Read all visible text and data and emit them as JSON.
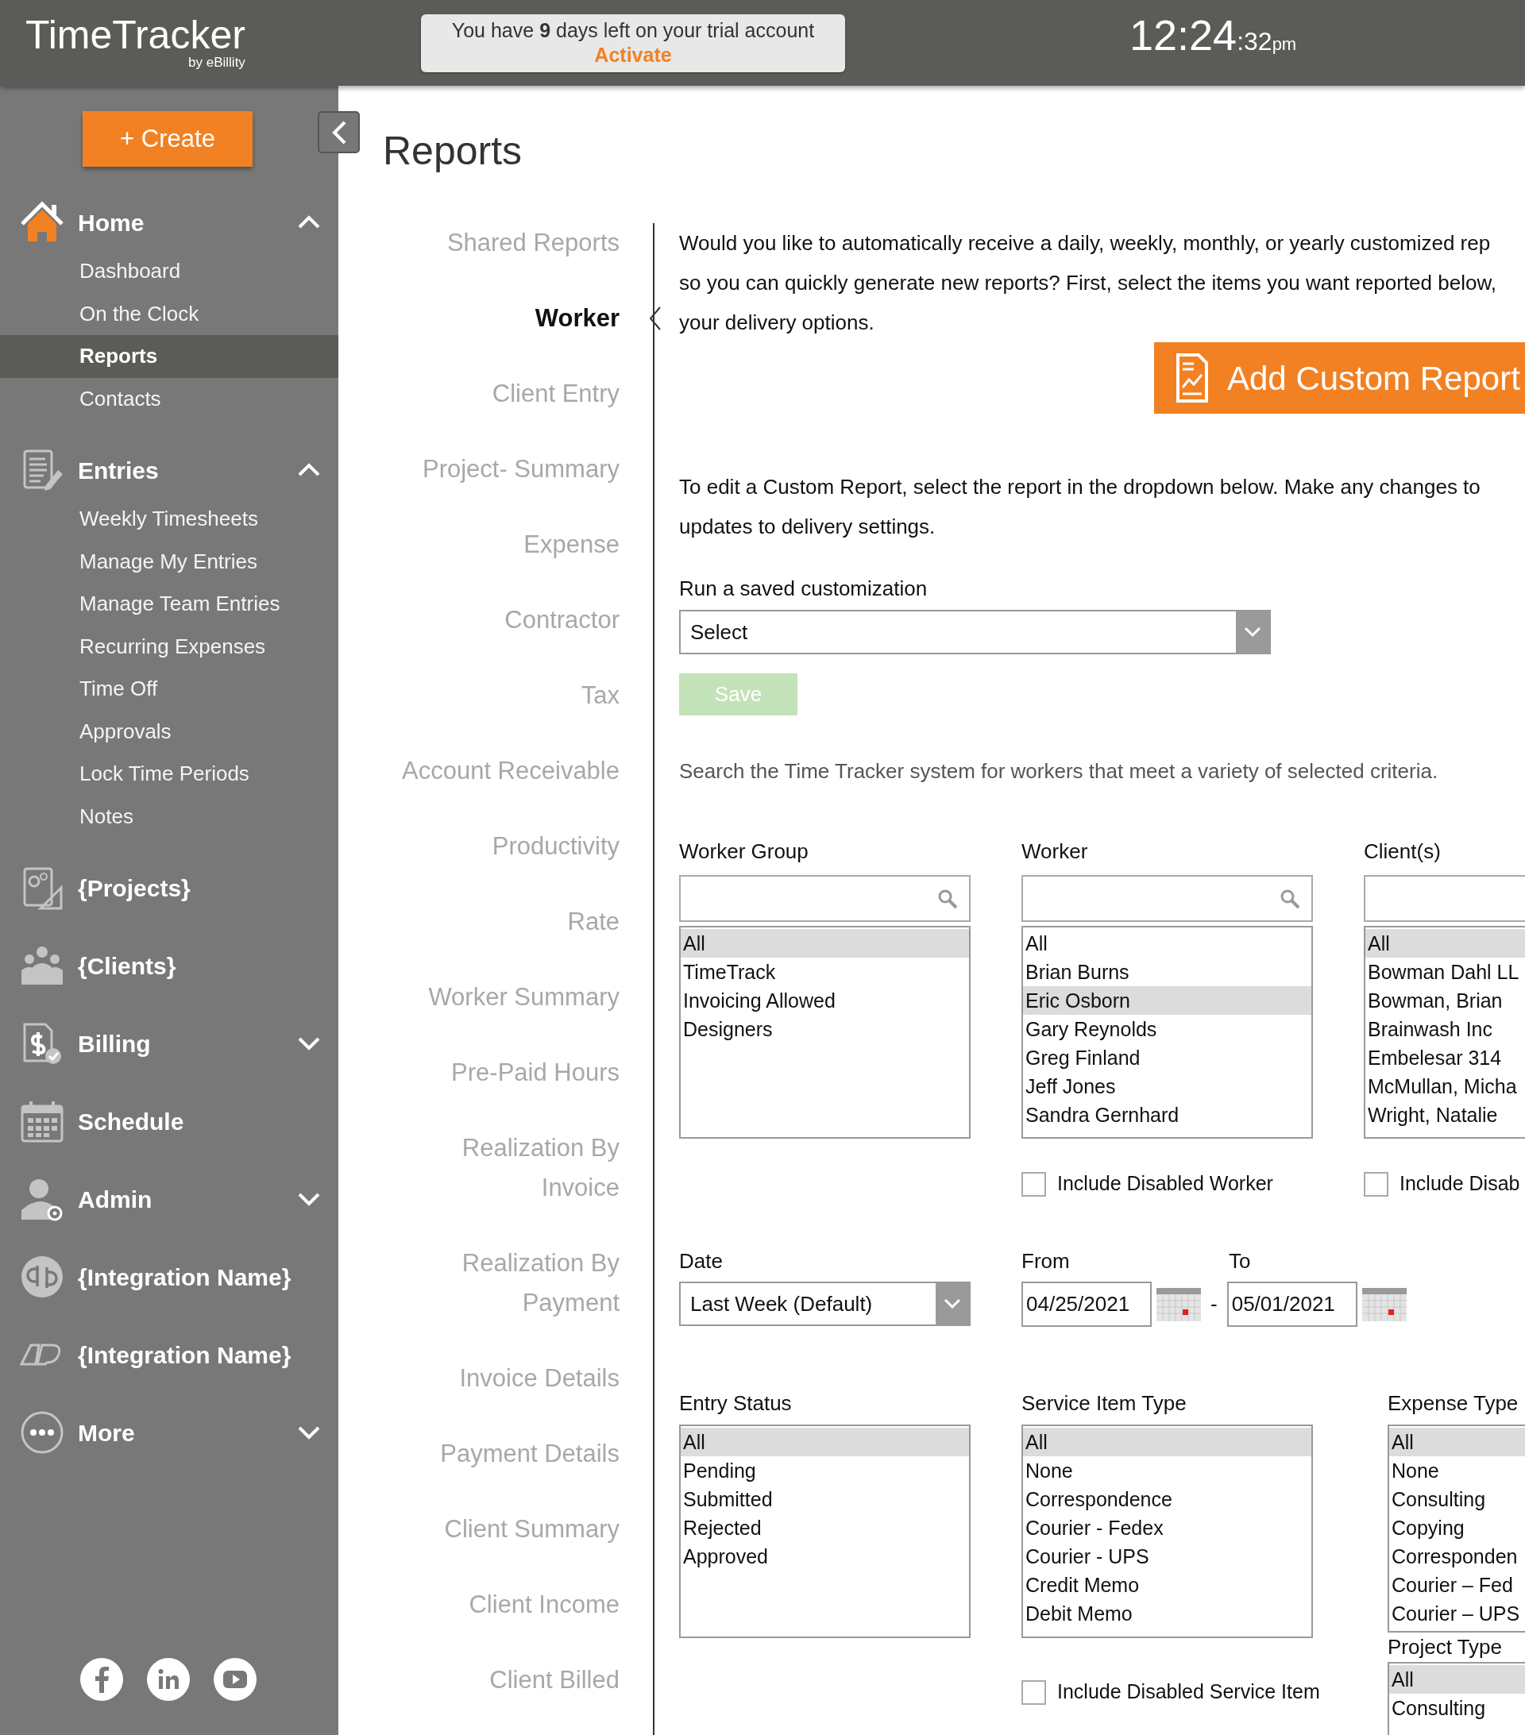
{
  "header": {
    "logo": "TimeTracker",
    "tagline": "by eBillity",
    "trial": {
      "message": "You have **9** days left on your trial account",
      "link": "Activate"
    },
    "clock": {
      "time": "12:24",
      "seconds": ":32",
      "period": "pm"
    }
  },
  "sidebar": {
    "create_button": "+ Create",
    "sections": [
      {
        "label": "Home",
        "expanded": true,
        "children": [
          {
            "label": "Dashboard",
            "selected": false
          },
          {
            "label": "On the Clock",
            "selected": false
          },
          {
            "label": "Reports",
            "selected": true
          },
          {
            "label": "Contacts",
            "selected": false
          }
        ]
      },
      {
        "label": "Entries",
        "expanded": true,
        "children": [
          {
            "label": "Weekly Timesheets",
            "selected": false
          },
          {
            "label": "Manage My Entries",
            "selected": false
          },
          {
            "label": "Manage Team Entries",
            "selected": false
          },
          {
            "label": "Recurring Expenses",
            "selected": false
          },
          {
            "label": "Time Off",
            "selected": false
          },
          {
            "label": "Approvals",
            "selected": false
          },
          {
            "label": "Lock Time Periods",
            "selected": false
          },
          {
            "label": "Notes",
            "selected": false
          }
        ]
      },
      {
        "label": "{Projects}"
      },
      {
        "label": "{Clients}"
      },
      {
        "label": "Billing",
        "expanded": false
      },
      {
        "label": "Schedule"
      },
      {
        "label": "Admin",
        "expanded": false
      },
      {
        "label": "{Integration Name}"
      },
      {
        "label": "{Integration Name}"
      },
      {
        "label": "More",
        "expanded": false
      }
    ]
  },
  "page": {
    "title": "Reports",
    "report_nav": [
      {
        "label": "Shared Reports",
        "selected": false
      },
      {
        "label": "Worker",
        "selected": true
      },
      {
        "label": "Client Entry",
        "selected": false
      },
      {
        "label": "Project- Summary",
        "selected": false
      },
      {
        "label": "Expense",
        "selected": false
      },
      {
        "label": "Contractor",
        "selected": false
      },
      {
        "label": "Tax",
        "selected": false
      },
      {
        "label": "Account Receivable",
        "selected": false
      },
      {
        "label": "Productivity",
        "selected": false
      },
      {
        "label": "Rate",
        "selected": false
      },
      {
        "label": "Worker Summary",
        "selected": false
      },
      {
        "label": "Pre-Paid Hours",
        "selected": false
      },
      {
        "label": "Realization By Invoice",
        "selected": false
      },
      {
        "label": "Realization By Payment",
        "selected": false
      },
      {
        "label": "Invoice Details",
        "selected": false
      },
      {
        "label": "Payment Details",
        "selected": false
      },
      {
        "label": "Client Summary",
        "selected": false
      },
      {
        "label": "Client Income",
        "selected": false
      },
      {
        "label": "Client Billed",
        "selected": false
      }
    ],
    "intro_lines": [
      "Would you like to automatically receive a daily, weekly, monthly, or yearly customized rep",
      "so you can quickly generate new reports? First, select the items you want reported below,",
      "your delivery options."
    ],
    "add_button": "Add Custom Report",
    "edit_lines": [
      "To edit a Custom Report, select the report in the dropdown below. Make any changes to",
      "updates to delivery settings."
    ],
    "saved": {
      "label": "Run a saved customization",
      "value": "Select"
    },
    "save_button": {
      "label": "Save",
      "disabled": true
    },
    "search_hint": "Search the Time Tracker system for workers that meet a variety of selected criteria.",
    "filters_top": [
      {
        "label": "Worker Group",
        "search_icon": true,
        "items": [
          {
            "label": "All",
            "selected": true
          },
          {
            "label": "TimeTrack",
            "selected": false
          },
          {
            "label": "Invoicing Allowed",
            "selected": false
          },
          {
            "label": "Designers",
            "selected": false
          }
        ]
      },
      {
        "label": "Worker",
        "search_icon": true,
        "items": [
          {
            "label": "All",
            "selected": false
          },
          {
            "label": "Brian Burns",
            "selected": false
          },
          {
            "label": "Eric Osborn",
            "selected": true
          },
          {
            "label": "Gary Reynolds",
            "selected": false
          },
          {
            "label": "Greg Finland",
            "selected": false
          },
          {
            "label": "Jeff Jones",
            "selected": false
          },
          {
            "label": "Sandra Gernhard",
            "selected": false
          }
        ],
        "checkbox": {
          "label": "Include Disabled Worker",
          "checked": false
        }
      },
      {
        "label": "Client(s)",
        "search_icon": false,
        "items": [
          {
            "label": "All",
            "selected": true
          },
          {
            "label": "Bowman Dahl LL",
            "selected": false
          },
          {
            "label": "Bowman, Brian",
            "selected": false
          },
          {
            "label": "Brainwash Inc",
            "selected": false
          },
          {
            "label": "Embelesar 314",
            "selected": false
          },
          {
            "label": "McMullan, Micha",
            "selected": false
          },
          {
            "label": "Wright, Natalie",
            "selected": false
          }
        ],
        "checkbox": {
          "label": "Include Disab",
          "checked": false
        }
      }
    ],
    "date": {
      "label": "Date",
      "value": "Last Week (Default)",
      "from_label": "From",
      "from_value": "04/25/2021",
      "separator": "-",
      "to_label": "To",
      "to_value": "05/01/2021"
    },
    "filters_bottom": [
      [
        {
          "label": "Entry Status",
          "items": [
            {
              "label": "All",
              "selected": true
            },
            {
              "label": "Pending",
              "selected": false
            },
            {
              "label": "Submitted",
              "selected": false
            },
            {
              "label": "Rejected",
              "selected": false
            },
            {
              "label": "Approved",
              "selected": false
            }
          ]
        }
      ],
      [
        {
          "label": "Service Item Type",
          "items": [
            {
              "label": "All",
              "selected": true
            },
            {
              "label": "None",
              "selected": false
            },
            {
              "label": "Correspondence",
              "selected": false
            },
            {
              "label": "Courier - Fedex",
              "selected": false
            },
            {
              "label": "Courier - UPS",
              "selected": false
            },
            {
              "label": "Credit Memo",
              "selected": false
            },
            {
              "label": "Debit Memo",
              "selected": false
            }
          ],
          "checkbox": {
            "label": "Include Disabled Service Item",
            "checked": false
          }
        }
      ],
      [
        {
          "label": "Expense Type",
          "items": [
            {
              "label": "All",
              "selected": true
            },
            {
              "label": "None",
              "selected": false
            },
            {
              "label": "Consulting",
              "selected": false
            },
            {
              "label": "Copying",
              "selected": false
            },
            {
              "label": "Corresponden",
              "selected": false
            },
            {
              "label": "Courier – Fed",
              "selected": false
            },
            {
              "label": "Courier – UPS",
              "selected": false
            }
          ]
        },
        {
          "label": "Project Type",
          "items": [
            {
              "label": "All",
              "selected": true
            },
            {
              "label": "Consulting",
              "selected": false
            }
          ]
        }
      ]
    ]
  }
}
